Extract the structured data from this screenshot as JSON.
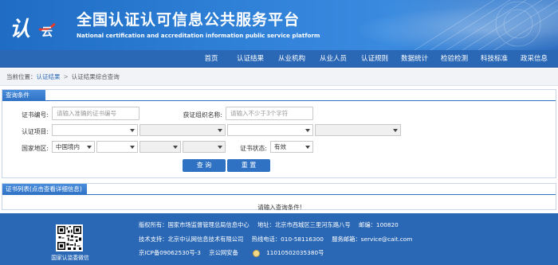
{
  "header": {
    "logo_char": "认",
    "logo_sub": "云",
    "title": "全国认证认可信息公共服务平台",
    "subtitle": "National certification and accreditation information public service platform"
  },
  "nav": {
    "items": [
      {
        "label": "首页"
      },
      {
        "label": "认证结果"
      },
      {
        "label": "从业机构"
      },
      {
        "label": "从业人员"
      },
      {
        "label": "认证规则"
      },
      {
        "label": "数据统计"
      },
      {
        "label": "检验检测"
      },
      {
        "label": "科技标准"
      },
      {
        "label": "政采信息"
      }
    ]
  },
  "breadcrumb": {
    "prefix": "当前位置：",
    "link": "认证结果",
    "separator": ">",
    "current": "认证结果综合查询"
  },
  "query": {
    "title": "查询条件",
    "cert_no_label": "证书编号:",
    "cert_no_placeholder": "请输入准确的证书编号",
    "org_label": "获证组织名称:",
    "org_placeholder": "请输入不少于3个字符",
    "project_label": "认证项目:",
    "region_label": "国家地区:",
    "region_value": "中国境内",
    "status_label": "证书状态:",
    "status_value": "有效",
    "search_button": "查 询",
    "reset_button": "重 置"
  },
  "results": {
    "title": "证书列表(点击查看详细信息)",
    "empty_message": "请输入查询条件!"
  },
  "footer": {
    "qr_caption": "国家认监委微信",
    "line1_a": "版权所有：国家市场监督管理总局信息中心",
    "line1_b": "地址：北京市西城区三里河东路八号",
    "line1_c": "邮编：100820",
    "line2_a": "技术支持：北京中认网信息技术有限公司",
    "line2_b": "热线电话：010-58116300",
    "line2_c": "服务邮箱：service@cait.com",
    "line3_a": "京ICP备09062530号-3",
    "line3_b": "京公网安备",
    "line3_c": "11010502035380号"
  },
  "colors": {
    "brand_blue": "#2a68b6",
    "panel_blue": "#2f72c4",
    "logo_red": "#e23b2c"
  }
}
